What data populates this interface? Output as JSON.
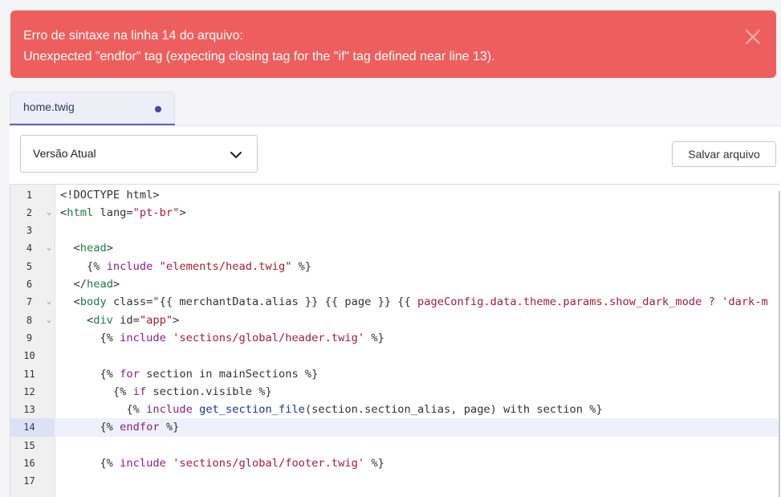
{
  "error": {
    "line1": "Erro de sintaxe na linha 14 do arquivo:",
    "line2": "Unexpected \"endfor\" tag (expecting closing tag for the \"if\" tag defined near line 13).",
    "close_icon": "close-icon",
    "color": "#ef5e5e"
  },
  "tab": {
    "label": "home.twig",
    "unsaved_indicator": "dot",
    "accent": "#4e3fb4"
  },
  "toolbar": {
    "version_value": "Versão Atual",
    "save_label": "Salvar arquivo"
  },
  "editor": {
    "active_line": 14,
    "lines": [
      {
        "n": "1",
        "fold": false,
        "tokens": [
          {
            "t": "<!DOCTYPE html>",
            "c": "punct"
          }
        ]
      },
      {
        "n": "2",
        "fold": true,
        "tokens": [
          {
            "t": "<",
            "c": "punct"
          },
          {
            "t": "html",
            "c": "tag"
          },
          {
            "t": " lang=",
            "c": "punct"
          },
          {
            "t": "\"pt-br\"",
            "c": "str"
          },
          {
            "t": ">",
            "c": "punct"
          }
        ]
      },
      {
        "n": "3",
        "fold": false,
        "tokens": []
      },
      {
        "n": "4",
        "fold": true,
        "tokens": [
          {
            "t": "  <",
            "c": "punct"
          },
          {
            "t": "head",
            "c": "tag"
          },
          {
            "t": ">",
            "c": "punct"
          }
        ]
      },
      {
        "n": "5",
        "fold": false,
        "tokens": [
          {
            "t": "    {% ",
            "c": "punct"
          },
          {
            "t": "include",
            "c": "kw"
          },
          {
            "t": " ",
            "c": "punct"
          },
          {
            "t": "\"elements/head.twig\"",
            "c": "str"
          },
          {
            "t": " %}",
            "c": "punct"
          }
        ]
      },
      {
        "n": "6",
        "fold": false,
        "tokens": [
          {
            "t": "  </",
            "c": "punct"
          },
          {
            "t": "head",
            "c": "tag"
          },
          {
            "t": ">",
            "c": "punct"
          }
        ]
      },
      {
        "n": "7",
        "fold": true,
        "tokens": [
          {
            "t": "  <",
            "c": "punct"
          },
          {
            "t": "body",
            "c": "tag"
          },
          {
            "t": " class=",
            "c": "punct"
          },
          {
            "t": "\"",
            "c": "str"
          },
          {
            "t": "{{ merchantData.alias }} {{ page }} {{ ",
            "c": "punct"
          },
          {
            "t": "pageConfig.data.theme.params.show_dark_mode ? 'dark-m",
            "c": "str"
          }
        ]
      },
      {
        "n": "8",
        "fold": true,
        "tokens": [
          {
            "t": "    <",
            "c": "punct"
          },
          {
            "t": "div",
            "c": "tag"
          },
          {
            "t": " id=",
            "c": "punct"
          },
          {
            "t": "\"app\"",
            "c": "str"
          },
          {
            "t": ">",
            "c": "punct"
          }
        ]
      },
      {
        "n": "9",
        "fold": false,
        "tokens": [
          {
            "t": "      {% ",
            "c": "punct"
          },
          {
            "t": "include",
            "c": "kw"
          },
          {
            "t": " ",
            "c": "punct"
          },
          {
            "t": "'sections/global/header.twig'",
            "c": "str"
          },
          {
            "t": " %}",
            "c": "punct"
          }
        ]
      },
      {
        "n": "10",
        "fold": false,
        "tokens": []
      },
      {
        "n": "11",
        "fold": false,
        "tokens": [
          {
            "t": "      {% ",
            "c": "punct"
          },
          {
            "t": "for",
            "c": "kw"
          },
          {
            "t": " section in mainSections %}",
            "c": "punct"
          }
        ]
      },
      {
        "n": "12",
        "fold": false,
        "tokens": [
          {
            "t": "        {% ",
            "c": "punct"
          },
          {
            "t": "if",
            "c": "kw"
          },
          {
            "t": " section.visible %}",
            "c": "punct"
          }
        ]
      },
      {
        "n": "13",
        "fold": false,
        "tokens": [
          {
            "t": "          {% ",
            "c": "punct"
          },
          {
            "t": "include",
            "c": "kw"
          },
          {
            "t": " ",
            "c": "punct"
          },
          {
            "t": "get_section_file",
            "c": "fn"
          },
          {
            "t": "(section.section_alias, page) with section %}",
            "c": "punct"
          }
        ]
      },
      {
        "n": "14",
        "fold": false,
        "tokens": [
          {
            "t": "      {% ",
            "c": "punct"
          },
          {
            "t": "endfor",
            "c": "kw"
          },
          {
            "t": " %}",
            "c": "punct"
          }
        ]
      },
      {
        "n": "15",
        "fold": false,
        "tokens": []
      },
      {
        "n": "16",
        "fold": false,
        "tokens": [
          {
            "t": "      {% ",
            "c": "punct"
          },
          {
            "t": "include",
            "c": "kw"
          },
          {
            "t": " ",
            "c": "punct"
          },
          {
            "t": "'sections/global/footer.twig'",
            "c": "str"
          },
          {
            "t": " %}",
            "c": "punct"
          }
        ]
      },
      {
        "n": "17",
        "fold": false,
        "tokens": []
      }
    ]
  }
}
